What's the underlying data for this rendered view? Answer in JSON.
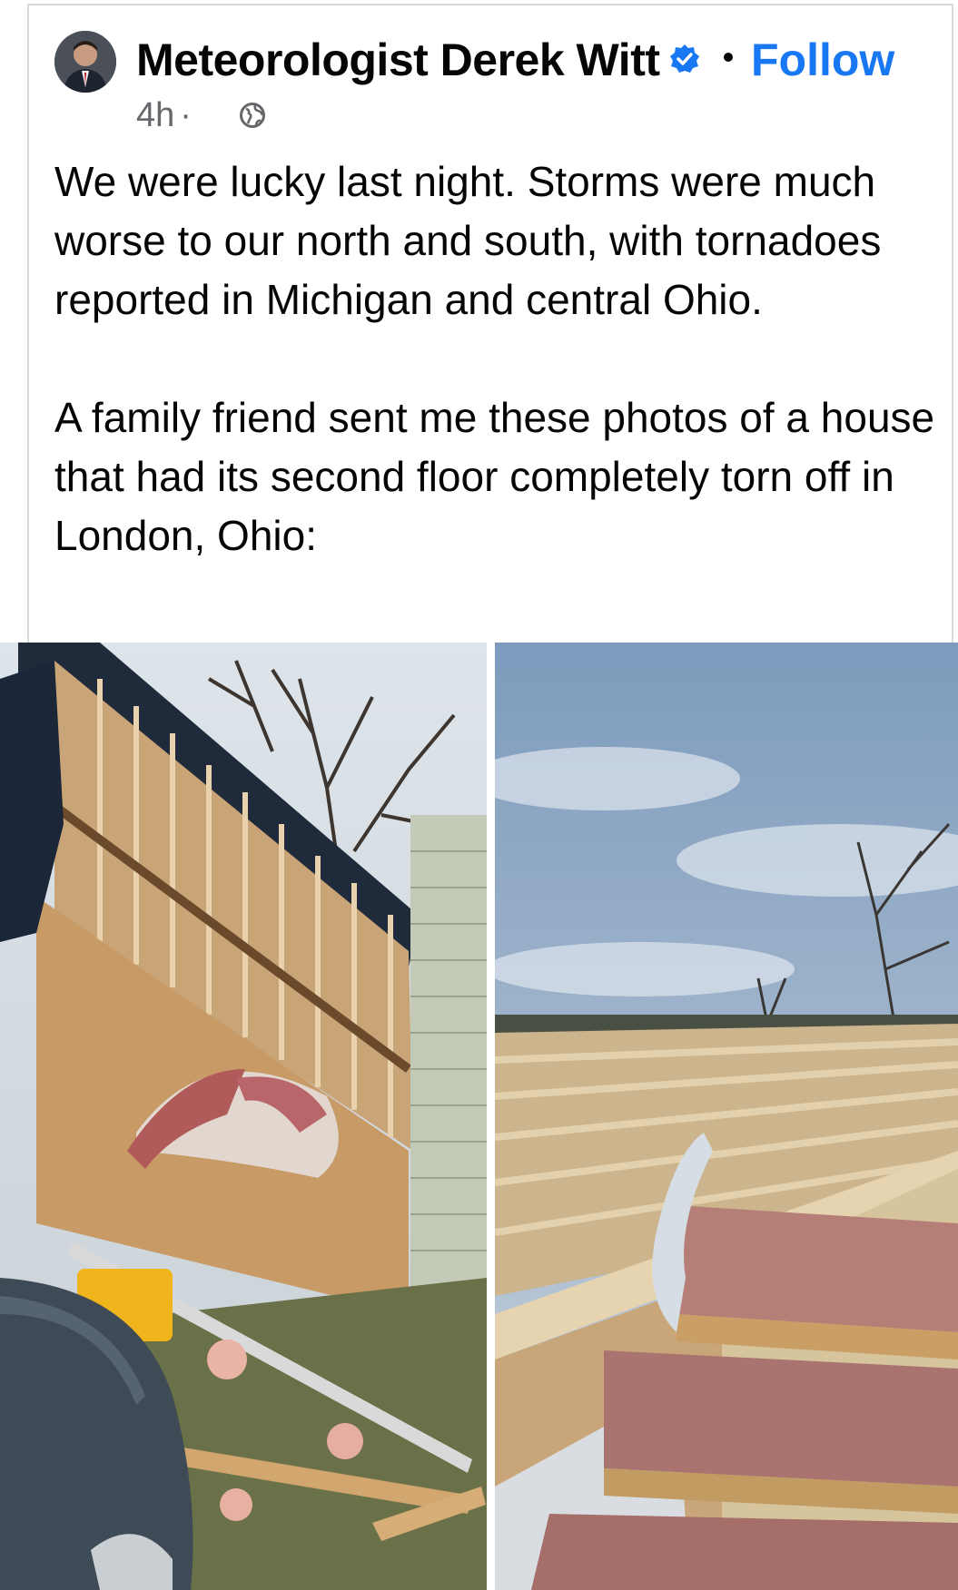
{
  "post": {
    "author": "Meteorologist Derek Witt",
    "verified_icon": "verified-badge-icon",
    "follow_label": "Follow",
    "timestamp": "4h",
    "separator": "·",
    "audience_icon": "globe-icon",
    "paragraphs": [
      "We were lucky last night. Storms were much worse to our north and south, with tornadoes reported in Michigan and central Ohio.",
      "A family friend sent me these photos of a house that had its second floor completely torn off in London, Ohio:"
    ]
  },
  "photos": [
    {
      "icon": "damaged-house-wall-photo"
    },
    {
      "icon": "torn-off-floor-stairs-photo"
    }
  ],
  "colors": {
    "follow": "#1877f2",
    "verified": "#1877f2",
    "meta_text": "#65676b",
    "text": "#050505"
  }
}
